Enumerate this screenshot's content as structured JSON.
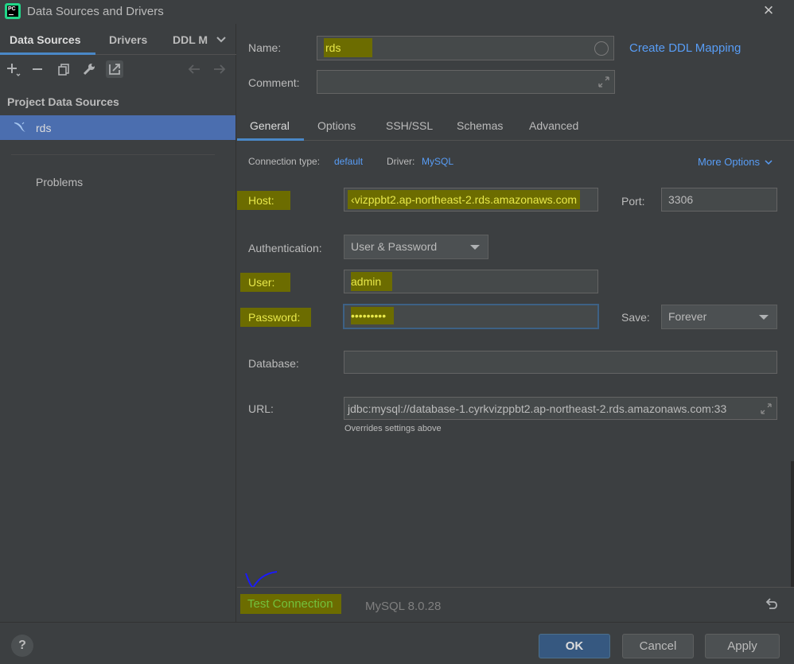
{
  "window": {
    "title": "Data Sources and Drivers",
    "close_icon": "×"
  },
  "left": {
    "tabs": [
      {
        "label": "Data Sources"
      },
      {
        "label": "Drivers"
      },
      {
        "label": "DDL M"
      }
    ],
    "section_title": "Project Data Sources",
    "data_source": {
      "label": "rds"
    },
    "problems_label": "Problems"
  },
  "form": {
    "name_label": "Name:",
    "name_value": "rds",
    "create_ddl_link": "Create DDL Mapping",
    "comment_label": "Comment:",
    "comment_value": "",
    "tabs": [
      {
        "label": "General"
      },
      {
        "label": "Options"
      },
      {
        "label": "SSH/SSL"
      },
      {
        "label": "Schemas"
      },
      {
        "label": "Advanced"
      }
    ],
    "connection_type_label": "Connection type:",
    "connection_type_value": "default",
    "driver_label": "Driver:",
    "driver_value": "MySQL",
    "more_options": "More Options",
    "host_label": "Host:",
    "host_value": "‹vizppbt2.ap-northeast-2.rds.amazonaws.com",
    "port_label": "Port:",
    "port_value": "3306",
    "auth_label": "Authentication:",
    "auth_value": "User & Password",
    "user_label": "User:",
    "user_value": "admin",
    "password_label": "Password:",
    "password_value": "•••••••••",
    "save_label": "Save:",
    "save_value": "Forever",
    "database_label": "Database:",
    "database_value": "",
    "url_label": "URL:",
    "url_value": "jdbc:mysql://database-1.cyrkvizppbt2.ap-northeast-2.rds.amazonaws.com:33",
    "url_hint": "Overrides settings above"
  },
  "bottom": {
    "test_connection": "Test Connection",
    "version": "MySQL 8.0.28"
  },
  "footer": {
    "help": "?",
    "ok": "OK",
    "cancel": "Cancel",
    "apply": "Apply"
  },
  "colors": {
    "accent": "#4a88c7",
    "selection": "#4b6eaf",
    "link": "#589df6",
    "highlight": "#6c6c00",
    "test_connection": "#5fa24d"
  }
}
